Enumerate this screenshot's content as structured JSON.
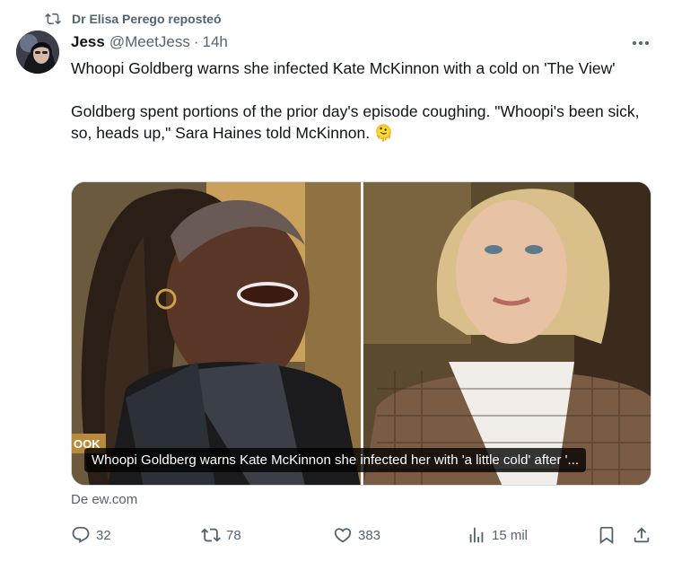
{
  "repost": {
    "label": "Dr Elisa Perego reposteó",
    "icon": "repost-icon"
  },
  "author": {
    "name": "Jess",
    "handle": "@MeetJess",
    "separator": "·",
    "time": "14h"
  },
  "tweet": {
    "paragraph1": "Whoopi Goldberg warns she infected Kate McKinnon with a cold on 'The View'",
    "paragraph2": "Goldberg spent portions of the prior day's episode coughing. \"Whoopi's been sick, so, heads up,\" Sara Haines told McKinnon. 🫠"
  },
  "media": {
    "caption": "Whoopi Goldberg warns Kate McKinnon she infected her with 'a little cold' after '...",
    "left_panel_text": "OOK"
  },
  "source": "De ew.com",
  "actions": {
    "replies": "32",
    "reposts": "78",
    "likes": "383",
    "views": "15 mil"
  },
  "colors": {
    "muted": "#536471",
    "text": "#0f1419",
    "border": "#cfd9de"
  }
}
